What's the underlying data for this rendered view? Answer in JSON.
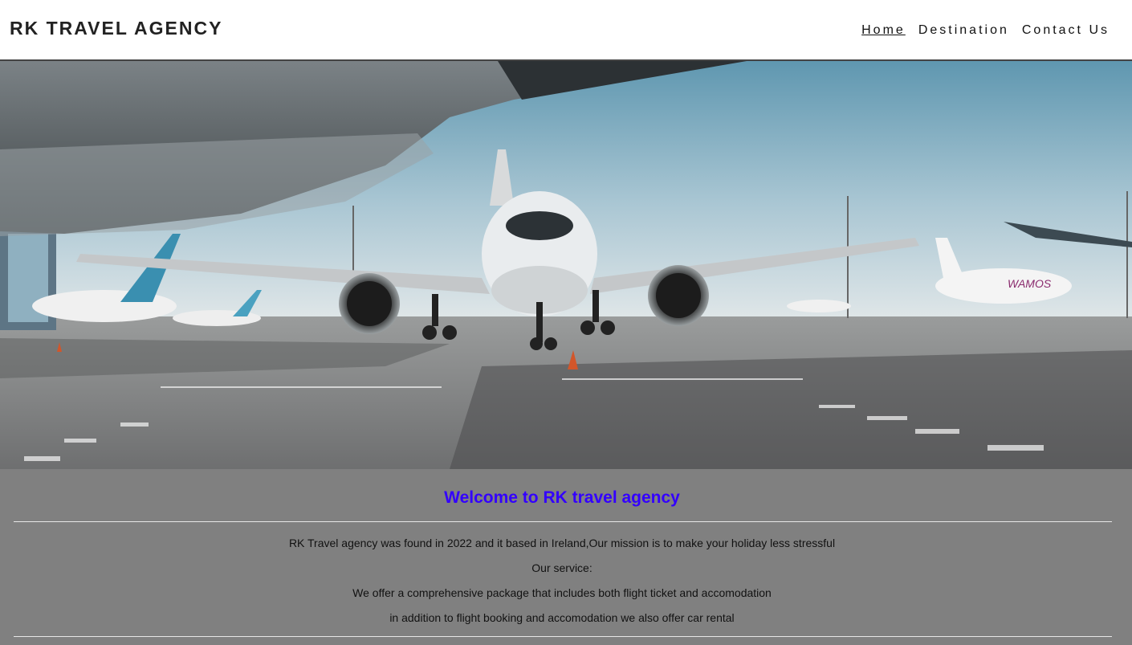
{
  "header": {
    "logo": "RK TRAVEL AGENCY",
    "nav": [
      {
        "label": "Home",
        "active": true
      },
      {
        "label": "Destination",
        "active": false
      },
      {
        "label": "Contact Us",
        "active": false
      }
    ]
  },
  "hero": {
    "image": "airplane-on-tarmac",
    "airline_text": "WAMOS"
  },
  "main": {
    "welcome": "Welcome to RK travel agency",
    "paragraphs": [
      "RK Travel agency was found in 2022 and it based in Ireland,Our mission is to make your holiday less stressful",
      "Our service:",
      "We offer a comprehensive package that includes both flight ticket and accomodation",
      "in addition to flight booking and accomodation we also offer car rental"
    ]
  },
  "colors": {
    "heading": "#3300ff",
    "content_bg": "#808080",
    "header_bg": "#ffffff"
  }
}
